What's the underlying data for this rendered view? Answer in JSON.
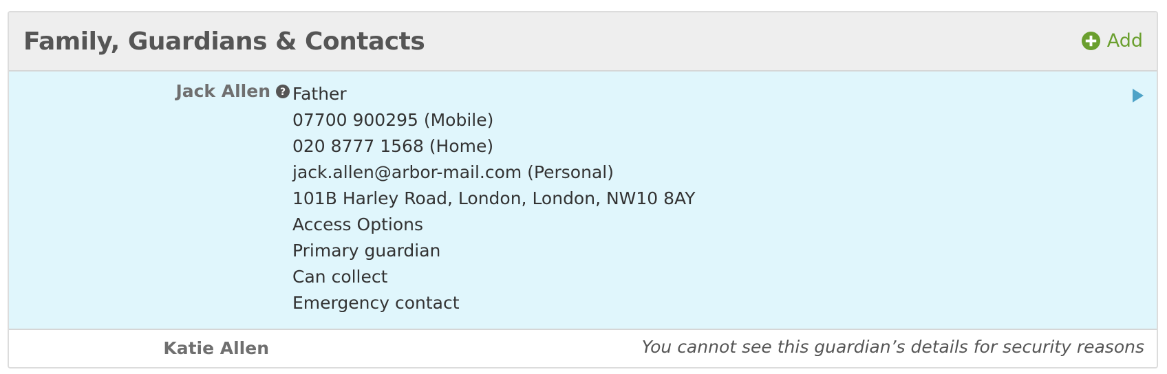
{
  "panel": {
    "title": "Family, Guardians & Contacts",
    "add_label": "Add",
    "add_icon": "plus-circle-icon",
    "accent_color": "#6a9f2e"
  },
  "contacts": [
    {
      "name": "Jack Allen",
      "help_icon": "question-circle-icon",
      "expand_icon": "triangle-right-icon",
      "highlighted": true,
      "details": [
        "Father",
        "07700 900295 (Mobile)",
        "020 8777 1568 (Home)",
        "jack.allen@arbor-mail.com (Personal)",
        "101B Harley Road, London, London, NW10 8AY",
        "Access Options",
        "Primary guardian",
        "Can collect",
        "Emergency contact"
      ]
    },
    {
      "name": "Katie Allen",
      "highlighted": false,
      "note": "You cannot see this guardian’s details for security reasons"
    }
  ],
  "colors": {
    "header_bg": "#eeeeee",
    "highlight_bg": "#e0f6fc",
    "arrow": "#4fa3c7"
  }
}
